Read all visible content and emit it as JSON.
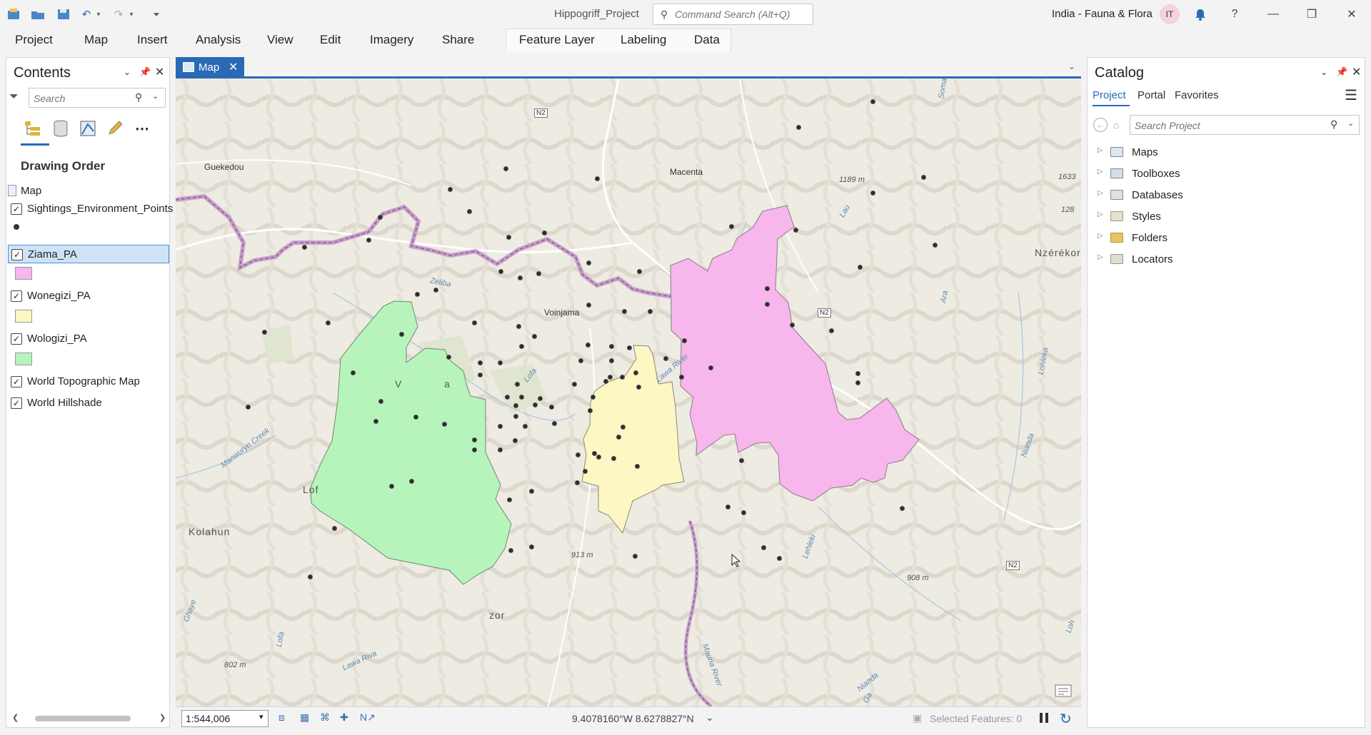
{
  "app": {
    "project_title": "Hippogriff_Project",
    "command_search_placeholder": "Command Search (Alt+Q)",
    "user_name": "India - Fauna & Flora",
    "user_initials": "IT"
  },
  "ribbon": {
    "tabs": [
      "Project",
      "Map",
      "Insert",
      "Analysis",
      "View",
      "Edit",
      "Imagery",
      "Share"
    ],
    "contextual_tabs": [
      "Feature Layer",
      "Labeling",
      "Data"
    ]
  },
  "contents": {
    "title": "Contents",
    "search_placeholder": "Search",
    "section": "Drawing Order",
    "map_name": "Map",
    "layers": [
      {
        "name": "Sightings_Environment_Points",
        "checked": true
      },
      {
        "name": "Ziama_PA",
        "checked": true,
        "selected": true,
        "color": "#f7b6ec"
      },
      {
        "name": "Wonegizi_PA",
        "checked": true,
        "color": "#fdf7c4"
      },
      {
        "name": "Wologizi_PA",
        "checked": true,
        "color": "#b6f4bc"
      },
      {
        "name": "World Topographic Map",
        "checked": true
      },
      {
        "name": "World Hillshade",
        "checked": true
      }
    ]
  },
  "map_view": {
    "tab_label": "Map",
    "place_labels": [
      "Guekedou",
      "Macenta",
      "Voinjama",
      "Kolahun",
      "Nzérékoré",
      "Lof",
      "V",
      "a",
      "zor"
    ],
    "elevation_labels": [
      "1189 m",
      "913 m",
      "908 m",
      "802 m",
      "1633",
      "128"
    ],
    "water_labels": [
      "Zeliba",
      "Lofa",
      "Manwuryn Creek",
      "Lawa River",
      "Lofa",
      "Ghaye",
      "Lawa Riva",
      "Mauna River",
      "Lehleki",
      "Nianda",
      "Lohleka",
      "Ara",
      "Lau",
      "Loh",
      "Ga",
      "Soma",
      "Nianda"
    ],
    "road_shields": [
      "N2",
      "N2",
      "N2"
    ]
  },
  "status_bar": {
    "scale": "1:544,006",
    "coordinates": "9.4078160°W 8.6278827°N",
    "selected_features": "Selected Features: 0"
  },
  "catalog": {
    "title": "Catalog",
    "tabs": [
      "Project",
      "Portal",
      "Favorites"
    ],
    "search_placeholder": "Search Project",
    "items": [
      "Maps",
      "Toolboxes",
      "Databases",
      "Styles",
      "Folders",
      "Locators"
    ]
  },
  "colors": {
    "accent": "#2a6ab5",
    "ziama_fill": "#f7b6ec",
    "wonegizi_fill": "#fdf7c4",
    "wologizi_fill": "#b6f4bc",
    "border_line": "#b07fb8"
  }
}
